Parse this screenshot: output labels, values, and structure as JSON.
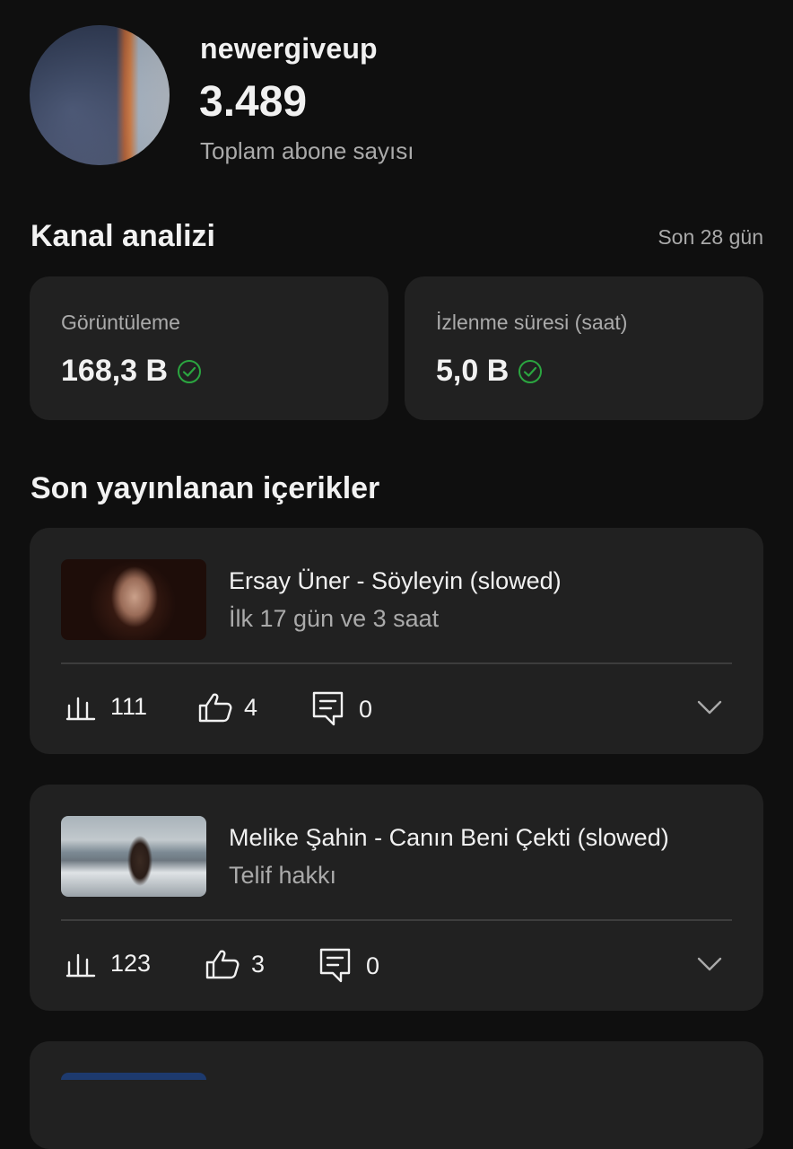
{
  "channel": {
    "name": "newergiveup",
    "subscriber_count": "3.489",
    "subscriber_label": "Toplam abone sayısı"
  },
  "analytics": {
    "title": "Kanal analizi",
    "range": "Son 28 gün",
    "cards": [
      {
        "label": "Görüntüleme",
        "value": "168,3 B"
      },
      {
        "label": "İzlenme süresi (saat)",
        "value": "5,0 B"
      }
    ],
    "accent_color": "#2ba640"
  },
  "recent": {
    "title": "Son yayınlanan içerikler",
    "videos": [
      {
        "title": "Ersay Üner - Söyleyin (slowed)",
        "subtitle": "İlk 17 gün ve 3 saat",
        "views": "111",
        "likes": "4",
        "comments": "0"
      },
      {
        "title": "Melike Şahin - Canın Beni Çekti (slowed)",
        "subtitle": "Telif hakkı",
        "views": "123",
        "likes": "3",
        "comments": "0"
      }
    ]
  },
  "icons": [
    "analytics-bars-icon",
    "thumbs-up-icon",
    "comment-icon",
    "chevron-down-icon",
    "check-circle-icon"
  ]
}
